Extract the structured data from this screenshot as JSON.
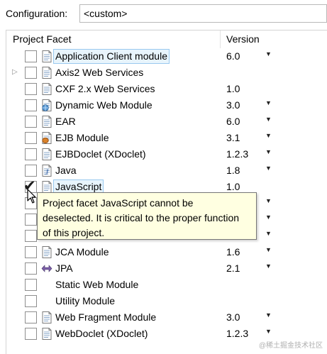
{
  "configuration": {
    "label": "Configuration:",
    "value": "<custom>"
  },
  "table": {
    "col_facet": "Project Facet",
    "col_version": "Version"
  },
  "facets": [
    {
      "name": "Application Client module",
      "version": "6.0",
      "checked": false,
      "dropdown": true,
      "expandable": false,
      "selected": true,
      "icon": "page-icon"
    },
    {
      "name": "Axis2 Web Services",
      "version": "",
      "checked": false,
      "dropdown": false,
      "expandable": true,
      "selected": false,
      "icon": "page-icon"
    },
    {
      "name": "CXF 2.x Web Services",
      "version": "1.0",
      "checked": false,
      "dropdown": false,
      "expandable": false,
      "selected": false,
      "icon": "page-icon"
    },
    {
      "name": "Dynamic Web Module",
      "version": "3.0",
      "checked": false,
      "dropdown": true,
      "expandable": false,
      "selected": false,
      "icon": "globe-page-icon"
    },
    {
      "name": "EAR",
      "version": "6.0",
      "checked": false,
      "dropdown": true,
      "expandable": false,
      "selected": false,
      "icon": "page-icon"
    },
    {
      "name": "EJB Module",
      "version": "3.1",
      "checked": false,
      "dropdown": true,
      "expandable": false,
      "selected": false,
      "icon": "bean-page-icon"
    },
    {
      "name": "EJBDoclet (XDoclet)",
      "version": "1.2.3",
      "checked": false,
      "dropdown": true,
      "expandable": false,
      "selected": false,
      "icon": "page-icon"
    },
    {
      "name": "Java",
      "version": "1.8",
      "checked": false,
      "dropdown": true,
      "expandable": false,
      "selected": false,
      "icon": "java-page-icon"
    },
    {
      "name": "JavaScript",
      "version": "1.0",
      "checked": true,
      "dropdown": false,
      "expandable": false,
      "selected": true,
      "icon": "page-icon"
    },
    {
      "name": "",
      "version": "",
      "checked": false,
      "dropdown": true,
      "expandable": false,
      "selected": false,
      "icon": ""
    },
    {
      "name": "",
      "version": "",
      "checked": false,
      "dropdown": true,
      "expandable": false,
      "selected": false,
      "icon": ""
    },
    {
      "name": "",
      "version": "",
      "checked": false,
      "dropdown": true,
      "expandable": false,
      "selected": false,
      "icon": ""
    },
    {
      "name": "JCA Module",
      "version": "1.6",
      "checked": false,
      "dropdown": true,
      "expandable": false,
      "selected": false,
      "icon": "page-icon"
    },
    {
      "name": "JPA",
      "version": "2.1",
      "checked": false,
      "dropdown": true,
      "expandable": false,
      "selected": false,
      "icon": "jpa-icon"
    },
    {
      "name": "Static Web Module",
      "version": "",
      "checked": false,
      "dropdown": false,
      "expandable": false,
      "selected": false,
      "icon": ""
    },
    {
      "name": "Utility Module",
      "version": "",
      "checked": false,
      "dropdown": false,
      "expandable": false,
      "selected": false,
      "icon": ""
    },
    {
      "name": "Web Fragment Module",
      "version": "3.0",
      "checked": false,
      "dropdown": true,
      "expandable": false,
      "selected": false,
      "icon": "page-icon"
    },
    {
      "name": "WebDoclet (XDoclet)",
      "version": "1.2.3",
      "checked": false,
      "dropdown": true,
      "expandable": false,
      "selected": false,
      "icon": "page-icon"
    }
  ],
  "tooltip": {
    "line1": "Project facet JavaScript cannot be",
    "line2": "deselected. It is critical to the proper function",
    "line3": "of this project."
  },
  "watermark": "@稀土掘金技术社区"
}
